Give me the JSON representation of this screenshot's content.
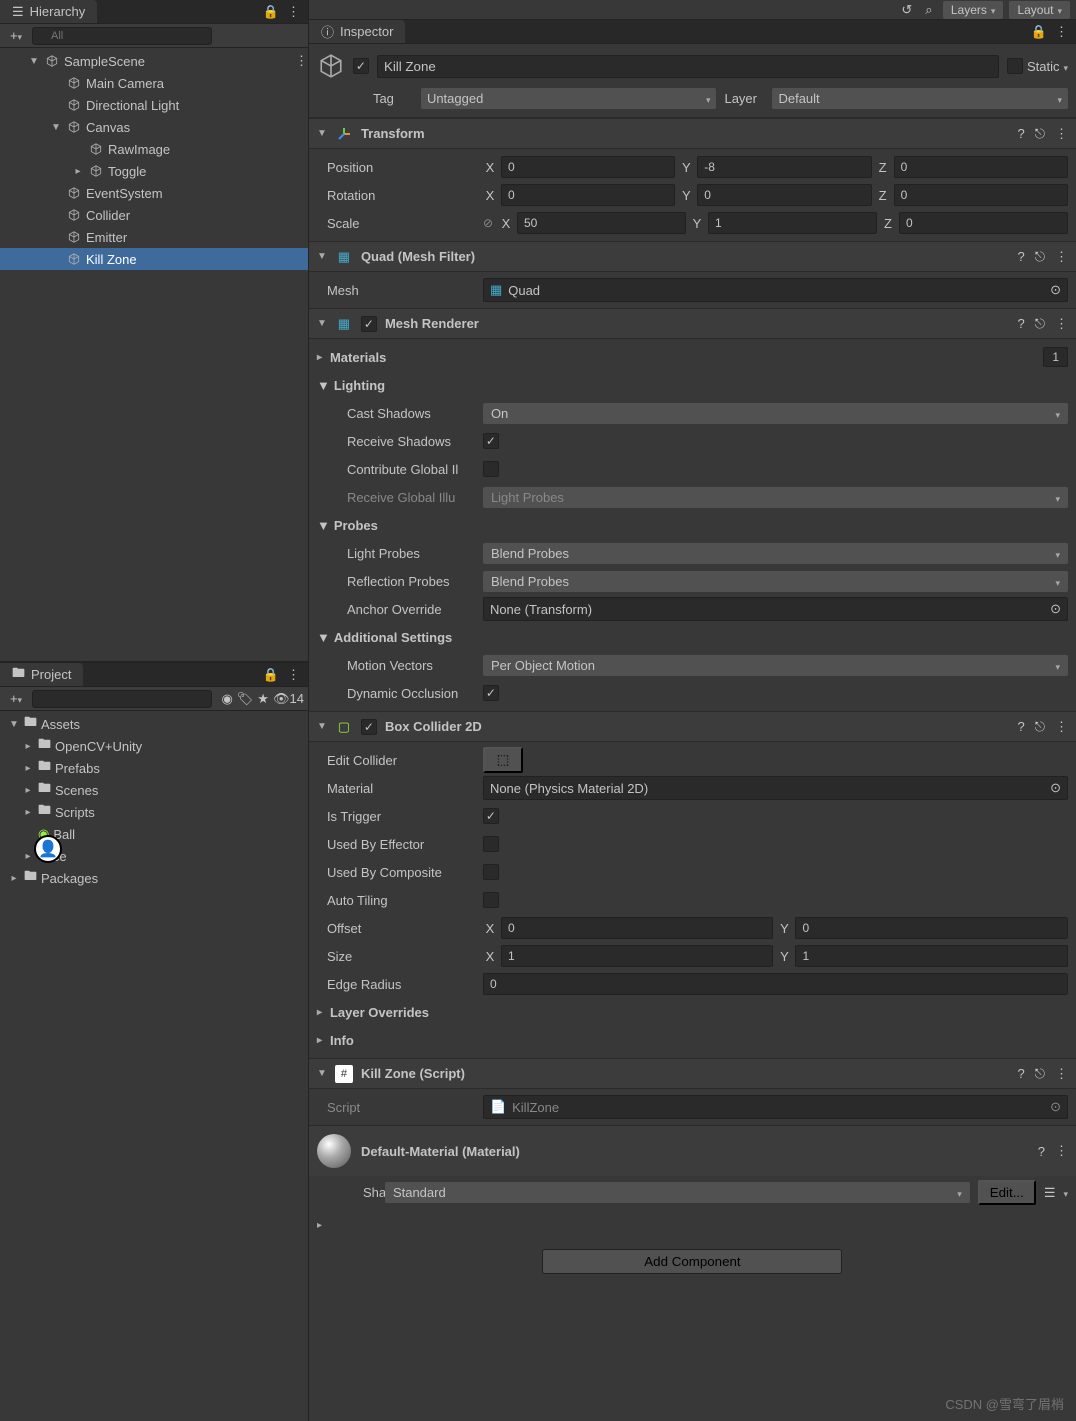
{
  "toolbar": {
    "layers_label": "Layers",
    "layout_label": "Layout"
  },
  "hierarchy": {
    "tab_title": "Hierarchy",
    "search_placeholder": "All",
    "items": [
      {
        "label": "SampleScene",
        "indent": 0,
        "fold": "down",
        "icon": "unity"
      },
      {
        "label": "Main Camera",
        "indent": 1,
        "icon": "cube"
      },
      {
        "label": "Directional Light",
        "indent": 1,
        "icon": "cube"
      },
      {
        "label": "Canvas",
        "indent": 1,
        "fold": "down",
        "icon": "cube"
      },
      {
        "label": "RawImage",
        "indent": 2,
        "icon": "cube"
      },
      {
        "label": "Toggle",
        "indent": 2,
        "fold": "right",
        "icon": "cube"
      },
      {
        "label": "EventSystem",
        "indent": 1,
        "icon": "cube"
      },
      {
        "label": "Collider",
        "indent": 1,
        "icon": "cube"
      },
      {
        "label": "Emitter",
        "indent": 1,
        "icon": "cube"
      },
      {
        "label": "Kill Zone",
        "indent": 1,
        "icon": "cube",
        "selected": true
      }
    ]
  },
  "project": {
    "tab_title": "Project",
    "hidden_count": "14",
    "items": [
      {
        "label": "Assets",
        "indent": 0,
        "fold": "down",
        "icon": "folder"
      },
      {
        "label": "OpenCV+Unity",
        "indent": 1,
        "fold": "right",
        "icon": "folder"
      },
      {
        "label": "Prefabs",
        "indent": 1,
        "fold": "right",
        "icon": "folder"
      },
      {
        "label": "Scenes",
        "indent": 1,
        "fold": "right",
        "icon": "folder"
      },
      {
        "label": "Scripts",
        "indent": 1,
        "fold": "right",
        "icon": "folder"
      },
      {
        "label": "Ball",
        "indent": 1,
        "icon": "ball"
      },
      {
        "label": "face",
        "indent": 1,
        "fold": "right",
        "icon": "asset"
      },
      {
        "label": "Packages",
        "indent": 0,
        "fold": "right",
        "icon": "folder"
      }
    ]
  },
  "inspector": {
    "tab_title": "Inspector",
    "object_name": "Kill Zone",
    "enabled": true,
    "static_label": "Static",
    "tag_label": "Tag",
    "tag_value": "Untagged",
    "layer_label": "Layer",
    "layer_value": "Default",
    "transform": {
      "title": "Transform",
      "position_label": "Position",
      "position": {
        "x": "0",
        "y": "-8",
        "z": "0"
      },
      "rotation_label": "Rotation",
      "rotation": {
        "x": "0",
        "y": "0",
        "z": "0"
      },
      "scale_label": "Scale",
      "scale": {
        "x": "50",
        "y": "1",
        "z": "0"
      }
    },
    "mesh_filter": {
      "title": "Quad (Mesh Filter)",
      "mesh_label": "Mesh",
      "mesh_value": "Quad"
    },
    "mesh_renderer": {
      "title": "Mesh Renderer",
      "enabled": true,
      "materials_label": "Materials",
      "materials_count": "1",
      "lighting_label": "Lighting",
      "cast_shadows_label": "Cast Shadows",
      "cast_shadows_value": "On",
      "receive_shadows_label": "Receive Shadows",
      "receive_shadows": true,
      "contribute_gi_label": "Contribute Global Il",
      "contribute_gi": false,
      "receive_gi_label": "Receive Global Illu",
      "receive_gi_value": "Light Probes",
      "probes_label": "Probes",
      "light_probes_label": "Light Probes",
      "light_probes_value": "Blend Probes",
      "reflection_probes_label": "Reflection Probes",
      "reflection_probes_value": "Blend Probes",
      "anchor_override_label": "Anchor Override",
      "anchor_override_value": "None (Transform)",
      "additional_label": "Additional Settings",
      "motion_vectors_label": "Motion Vectors",
      "motion_vectors_value": "Per Object Motion",
      "dynamic_occlusion_label": "Dynamic Occlusion",
      "dynamic_occlusion": true
    },
    "box_collider": {
      "title": "Box Collider 2D",
      "enabled": true,
      "edit_collider_label": "Edit Collider",
      "material_label": "Material",
      "material_value": "None (Physics Material 2D)",
      "is_trigger_label": "Is Trigger",
      "is_trigger": true,
      "used_by_effector_label": "Used By Effector",
      "used_by_effector": false,
      "used_by_composite_label": "Used By Composite",
      "used_by_composite": false,
      "auto_tiling_label": "Auto Tiling",
      "auto_tiling": false,
      "offset_label": "Offset",
      "offset": {
        "x": "0",
        "y": "0"
      },
      "size_label": "Size",
      "size": {
        "x": "1",
        "y": "1"
      },
      "edge_radius_label": "Edge Radius",
      "edge_radius_value": "0",
      "layer_overrides_label": "Layer Overrides",
      "info_label": "Info"
    },
    "script": {
      "title": "Kill Zone (Script)",
      "script_label": "Script",
      "script_value": "KillZone"
    },
    "material": {
      "title": "Default-Material (Material)",
      "shader_label": "Shader",
      "shader_value": "Standard",
      "edit_label": "Edit..."
    },
    "add_component_label": "Add Component"
  },
  "watermark": "CSDN @雪弯了眉梢"
}
